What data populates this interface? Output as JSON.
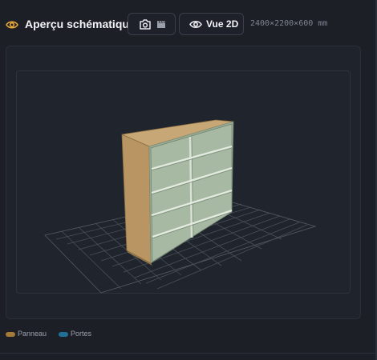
{
  "header": {
    "title": "Aperçu schématique",
    "title_icon": "eye-icon",
    "capture_button": {
      "icon": "camera-icon",
      "secondary_icon": "clapperboard-icon"
    },
    "view_button": {
      "icon": "eye-icon",
      "label": "Vue 2D"
    },
    "dimensions": "2400×2200×600 mm"
  },
  "viewport": {
    "description_type": "3d-furniture-preview",
    "grid": true,
    "colors": {
      "panel": "#b89562",
      "interior": "#a7b9a2",
      "back": "#98ab94",
      "grid": "#4a4f58",
      "background": "#20252d"
    }
  },
  "legend": [
    {
      "label": "Panneau",
      "color": "#a37a38"
    },
    {
      "label": "Portes",
      "color": "#1f6f99"
    }
  ],
  "colors": {
    "accent": "#e8a93a",
    "page_bg": "#1c1f26"
  }
}
